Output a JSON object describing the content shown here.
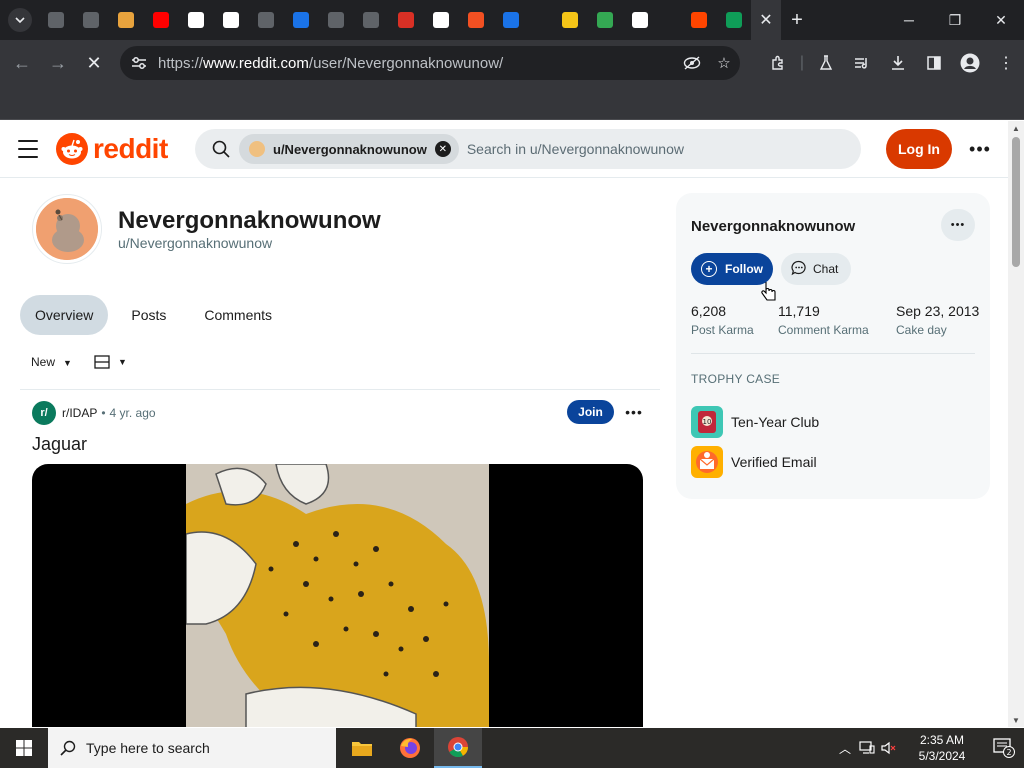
{
  "browser": {
    "tabs": [
      {
        "icon": "tab-favicon-1",
        "color": "#5f6368"
      },
      {
        "icon": "tab-favicon-2",
        "color": "#5f6368"
      },
      {
        "icon": "tab-favicon-3",
        "color": "#e8a33d"
      },
      {
        "icon": "youtube-icon",
        "color": "#ff0000"
      },
      {
        "icon": "tab-favicon-5",
        "color": "#ffffff"
      },
      {
        "icon": "wikipedia-icon",
        "color": "#ffffff"
      },
      {
        "icon": "tab-favicon-7",
        "color": "#5f6368"
      },
      {
        "icon": "tab-favicon-8",
        "color": "#1a73e8"
      },
      {
        "icon": "tab-favicon-9",
        "color": "#5f6368"
      },
      {
        "icon": "tab-favicon-10",
        "color": "#5f6368"
      },
      {
        "icon": "tab-favicon-11",
        "color": "#d93025"
      },
      {
        "icon": "wikipedia-icon",
        "color": "#ffffff"
      },
      {
        "icon": "microsoft-icon",
        "color": "#f25022"
      },
      {
        "icon": "settings-icon",
        "color": "#1a73e8"
      },
      {
        "icon": "tab-favicon-15",
        "color": "#202124"
      },
      {
        "icon": "imdb-icon",
        "color": "#f5c518"
      },
      {
        "icon": "tab-favicon-17",
        "color": "#34a853"
      },
      {
        "icon": "amazon-icon",
        "color": "#ffffff"
      },
      {
        "icon": "tab-favicon-19",
        "color": "#202124"
      },
      {
        "icon": "reddit-icon",
        "color": "#ff4500"
      },
      {
        "icon": "tab-favicon-21",
        "color": "#0f9d58"
      }
    ],
    "url_prefix": "https://",
    "url_host": "www.reddit.com",
    "url_path": "/user/Nevergonnaknowunow/"
  },
  "reddit": {
    "logo_text": "reddit",
    "search_chip": "u/Nevergonnaknowunow",
    "search_placeholder": "Search in u/Nevergonnaknowunow",
    "login_label": "Log In",
    "profile": {
      "display_name": "Nevergonnaknowunow",
      "username": "u/Nevergonnaknowunow"
    },
    "tabs": [
      {
        "label": "Overview",
        "active": true
      },
      {
        "label": "Posts",
        "active": false
      },
      {
        "label": "Comments",
        "active": false
      }
    ],
    "sort_label": "New",
    "post": {
      "subreddit": "r/IDAP",
      "subreddit_icon_text": "r/",
      "separator": "•",
      "age": "4 yr. ago",
      "join_label": "Join",
      "title": "Jaguar"
    },
    "sidebar": {
      "name": "Nevergonnaknowunow",
      "follow_label": "Follow",
      "chat_label": "Chat",
      "stats": [
        {
          "value": "6,208",
          "label": "Post Karma"
        },
        {
          "value": "11,719",
          "label": "Comment Karma"
        },
        {
          "value": "Sep 23, 2013",
          "label": "Cake day"
        }
      ],
      "trophy_heading": "TROPHY CASE",
      "trophies": [
        {
          "label": "Ten-Year Club",
          "icon": "ten-year-club-icon"
        },
        {
          "label": "Verified Email",
          "icon": "verified-email-icon"
        }
      ]
    }
  },
  "taskbar": {
    "search_placeholder": "Type here to search",
    "time": "2:35 AM",
    "date": "5/3/2024",
    "notification_count": "2"
  },
  "colors": {
    "reddit_orange": "#ff4500",
    "login_bg": "#d93900",
    "follow_bg": "#0a449b",
    "join_bg": "#0a449b"
  }
}
